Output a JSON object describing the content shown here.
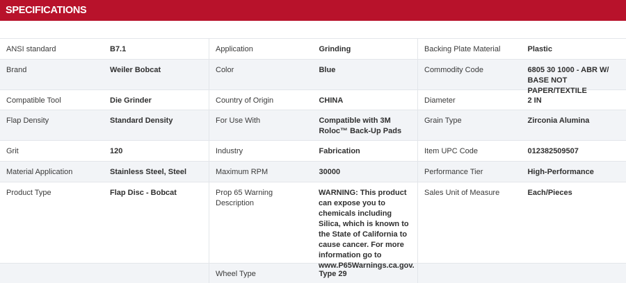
{
  "header": {
    "title": "SPECIFICATIONS"
  },
  "rows": [
    [
      {
        "label": "ANSI standard",
        "value": "B7.1"
      },
      {
        "label": "Application",
        "value": "Grinding"
      },
      {
        "label": "Backing Plate Material",
        "value": "Plastic"
      }
    ],
    [
      {
        "label": "Brand",
        "value": "Weiler Bobcat"
      },
      {
        "label": "Color",
        "value": "Blue"
      },
      {
        "label": "Commodity Code",
        "value": "6805 30 1000 - ABR W/ BASE NOT PAPER/TEXTILE"
      }
    ],
    [
      {
        "label": "Compatible Tool",
        "value": "Die Grinder"
      },
      {
        "label": "Country of Origin",
        "value": "CHINA"
      },
      {
        "label": "Diameter",
        "value": "2 IN"
      }
    ],
    [
      {
        "label": "Flap Density",
        "value": "Standard Density"
      },
      {
        "label": "For Use With",
        "value": "Compatible with 3M Roloc™ Back-Up Pads"
      },
      {
        "label": "Grain Type",
        "value": "Zirconia Alumina"
      }
    ],
    [
      {
        "label": "Grit",
        "value": "120"
      },
      {
        "label": "Industry",
        "value": "Fabrication"
      },
      {
        "label": "Item UPC Code",
        "value": "012382509507"
      }
    ],
    [
      {
        "label": "Material Application",
        "value": "Stainless Steel, Steel"
      },
      {
        "label": "Maximum RPM",
        "value": "30000"
      },
      {
        "label": "Performance Tier",
        "value": "High-Performance"
      }
    ],
    [
      {
        "label": "Product Type",
        "value": "Flap Disc - Bobcat"
      },
      {
        "label": "Prop 65 Warning Description",
        "value": "WARNING: This product can expose you to chemicals including Silica, which is known to the State of California to cause cancer. For more information go to www.P65Warnings.ca.gov."
      },
      {
        "label": "Sales Unit of Measure",
        "value": "Each/Pieces"
      }
    ],
    [
      {
        "label": "",
        "value": ""
      },
      {
        "label": "Wheel Type",
        "value": "Type 29"
      },
      {
        "label": "",
        "value": ""
      }
    ]
  ]
}
